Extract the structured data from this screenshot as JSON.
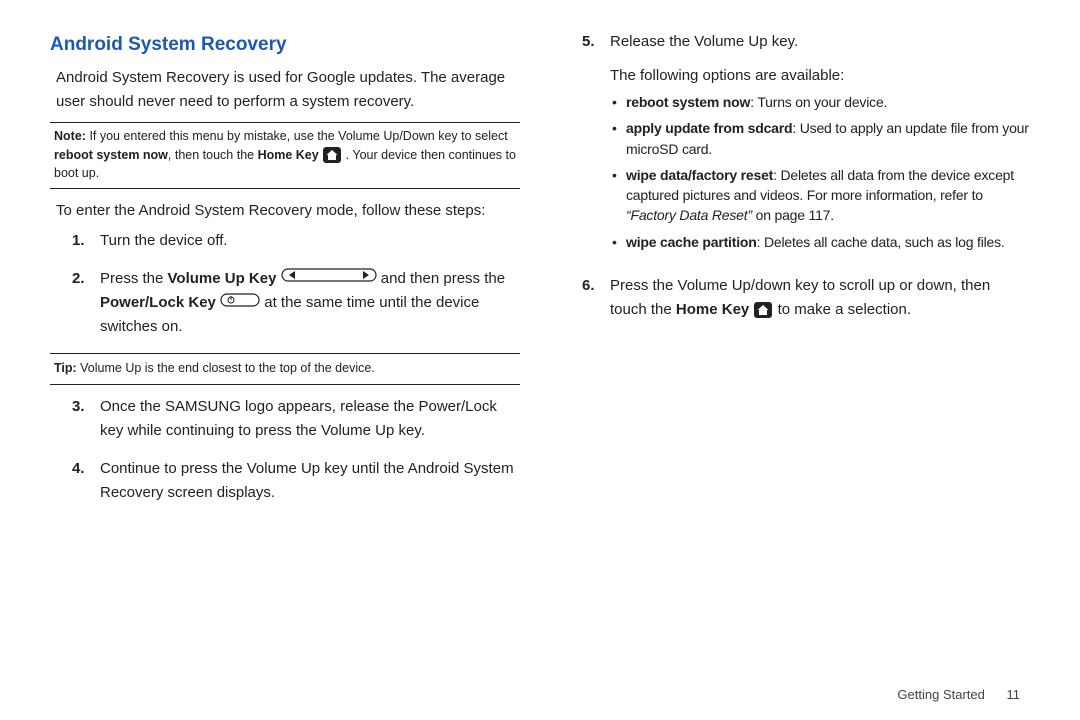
{
  "heading": "Android System Recovery",
  "intro": "Android System Recovery is used for Google updates. The average user should never need to perform a system recovery.",
  "note": {
    "label": "Note:",
    "l1a": "If you entered this menu by mistake, use the Volume Up/Down key to select ",
    "l1b": "reboot system now",
    "l1c": ", then touch the ",
    "l1d": "Home Key",
    "l1e": " . Your device then continues to boot up."
  },
  "lead": "To enter the Android System Recovery mode, follow these steps:",
  "s1": {
    "num": "1.",
    "text": "Turn the device off."
  },
  "s2": {
    "num": "2.",
    "a": "Press the ",
    "b": "Volume Up Key",
    "c": " and then press the ",
    "d": "Power/Lock Key",
    "e": " at the same time until the device switches on."
  },
  "tip": {
    "label": "Tip:",
    "text": " Volume Up is the end closest to the top of the device."
  },
  "s3": {
    "num": "3.",
    "text": "Once the SAMSUNG logo appears, release the Power/Lock key while continuing to press the Volume Up key."
  },
  "s4": {
    "num": "4.",
    "text": "Continue to press the Volume Up key until the Android System Recovery screen displays."
  },
  "s5": {
    "num": "5.",
    "a": "Release the Volume Up key.",
    "b": "The following options are available:"
  },
  "opt1": {
    "b": "reboot system now",
    "t": ": Turns on your device."
  },
  "opt2": {
    "b": "apply update from sdcard",
    "t": ": Used to apply an update file from your microSD card."
  },
  "opt3": {
    "b": "wipe data/factory reset",
    "t1": ": Deletes all data from the device except captured pictures and videos. For more information, refer to ",
    "ref": "“Factory Data Reset”",
    "t2": "  on page 117."
  },
  "opt4": {
    "b": "wipe cache partition",
    "t": ": Deletes all cache data, such as log files."
  },
  "s6": {
    "num": "6.",
    "a": "Press the Volume Up/down key to scroll up or down, then touch the ",
    "b": "Home Key",
    "c": " to make a selection."
  },
  "footer": {
    "section": "Getting Started",
    "page": "11"
  }
}
